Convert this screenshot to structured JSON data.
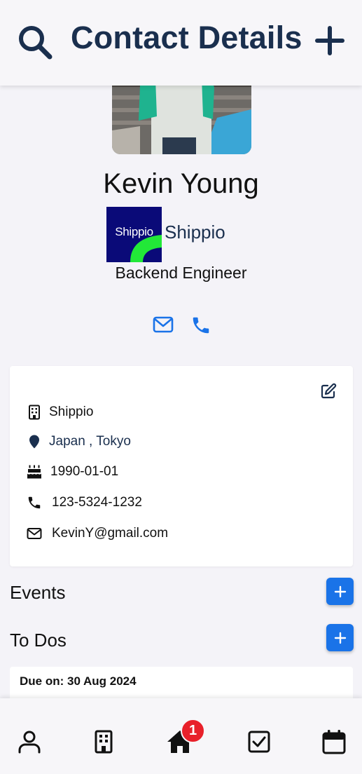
{
  "header": {
    "title": "Contact Details",
    "search_icon": "search-icon",
    "add_icon": "plus-icon"
  },
  "contact": {
    "name": "Kevin Young",
    "company": "Shippio",
    "company_logo_text": "Shippio",
    "job_title": "Backend Engineer"
  },
  "actions": {
    "mail_icon": "envelope-icon",
    "phone_icon": "phone-icon"
  },
  "details": {
    "company": "Shippio",
    "location": "Japan , Tokyo",
    "birthday": "1990-01-01",
    "phone": "123-5324-1232",
    "email": "KevinY@gmail.com"
  },
  "events": {
    "title": "Events"
  },
  "todos": {
    "title": "To Dos",
    "items": [
      {
        "due": "Due on: 30 Aug 2024"
      }
    ]
  },
  "nav": {
    "items": [
      "contacts",
      "companies",
      "home",
      "tasks",
      "calendar"
    ],
    "home_badge": "1"
  },
  "colors": {
    "primary": "#1a2f4e",
    "accent": "#1a73e8",
    "badge": "#e8202a",
    "logo_bg": "#0a0a78",
    "logo_green": "#22e838"
  }
}
